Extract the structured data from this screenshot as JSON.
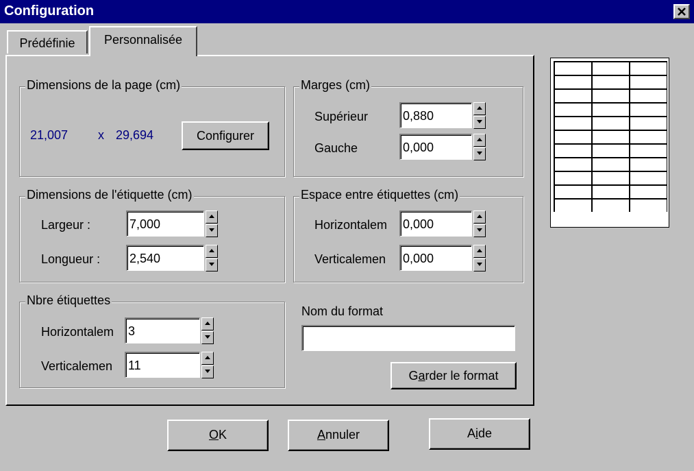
{
  "window": {
    "title": "Configuration",
    "close_icon": "close-icon"
  },
  "tabs": [
    {
      "label": "Prédéfinie",
      "active": false
    },
    {
      "label": "Personnalisée",
      "active": true
    }
  ],
  "page_dimensions": {
    "legend": "Dimensions de la page (cm)",
    "width": "21,007",
    "separator": "x",
    "height": "29,694",
    "configure_button": "Configurer"
  },
  "margins": {
    "legend": "Marges (cm)",
    "top_label": "Supérieur",
    "top_value": "0,880",
    "left_label": "Gauche",
    "left_value": "0,000"
  },
  "label_dimensions": {
    "legend": "Dimensions de l'étiquette (cm)",
    "width_label": "Largeur :",
    "width_value": "7,000",
    "length_label": "Longueur :",
    "length_value": "2,540"
  },
  "spacing": {
    "legend": "Espace entre étiquettes (cm)",
    "horizontal_label": "Horizontalem",
    "horizontal_value": "0,000",
    "vertical_label": "Verticalemen",
    "vertical_value": "0,000"
  },
  "label_count": {
    "legend": "Nbre étiquettes",
    "horizontal_label": "Horizontalem",
    "horizontal_value": "3",
    "vertical_label": "Verticalemen",
    "vertical_value": "11"
  },
  "format": {
    "name_label": "Nom du format",
    "name_value": "",
    "keep_button": "Garder le format",
    "keep_accel": "a"
  },
  "buttons": {
    "ok": "OK",
    "cancel": "Annuler",
    "help": "Aide"
  },
  "preview": {
    "columns": 3,
    "rows": 11
  },
  "colors": {
    "title_bar": "#000080",
    "face": "#c0c0c0",
    "value_text": "#000080"
  }
}
